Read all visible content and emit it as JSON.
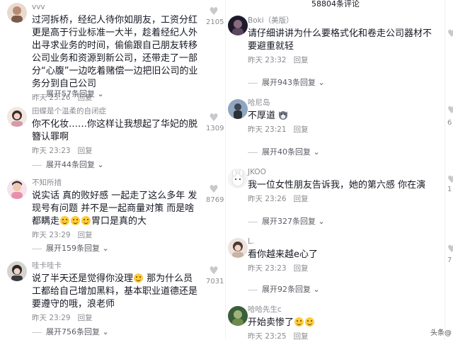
{
  "header": {
    "comment_count": "58804条评论"
  },
  "labels": {
    "reply": "回复"
  },
  "watermark": "头条@",
  "left_comments": [
    {
      "user": "vvv",
      "text": "过河拆桥，经纪人待你如朋友，工资分红更是高于行业标准一大半，趁着经纪人外出寻求业务的时间，偷偷跟自己朋友转移公司业务和资源到新公司，还带走了一部分“心腹”一边吃着赌偿一边把旧公司的业务分到自己公司",
      "time": "昨天 23:26",
      "expand": "展开57条回复",
      "likes": "2105"
    },
    {
      "user": "田蝶是个温柔的自闭症",
      "text": "你不化妆……你这样让我想起了华妃的脱簪认罪啊",
      "time": "昨天 23:23",
      "expand": "展开44条回复",
      "likes": "1309"
    },
    {
      "user": "不知所措",
      "text": "说实话 真的败好感 一起走了这么多年 发现号有问题 并不是一起商量对策 而是啥都瞒走",
      "text_tail": "胃口是真的大",
      "time": "昨天 23:29",
      "expand": "展开159条回复",
      "likes": "8769"
    },
    {
      "user": "哇卡哇卡",
      "text_head": "说了半天还是觉得你没理",
      "text": "那为什么员工都给自己增加黑料，基本职业道德还是要遵守的哦，浪老师",
      "time": "昨天 23:29",
      "expand": "展开756条回复",
      "likes": "7031"
    }
  ],
  "mid_comments": [
    {
      "user": "Boki（美版）",
      "text": "请仔细讲讲为什么要格式化和卷走公司器材不要避重就轻",
      "time": "昨天 23:32",
      "expand": "展开943条回复"
    },
    {
      "user": "哈尼岛",
      "text": "不厚道",
      "time": "昨天 23:21",
      "expand": "展开40条回复"
    },
    {
      "user": "JKOO",
      "text": "我一位女性朋友告诉我，她的第六感 你在演",
      "time": "昨天 23:26",
      "expand": "展开327条回复"
    },
    {
      "user": "L.",
      "text": "看你越来越e心了",
      "time": "昨天 23:23",
      "expand": "展开92条回复"
    },
    {
      "user": "哈哈先生c",
      "text": "开始卖惨了",
      "time": "昨天 23:25"
    }
  ],
  "right_partial": {
    "n1": "6",
    "n2": "7",
    "n3": "1"
  },
  "colors": {
    "text": "#161823",
    "muted": "#8a8b91",
    "heart": "#c8c8cc",
    "emoji": "#ffcc3d"
  }
}
